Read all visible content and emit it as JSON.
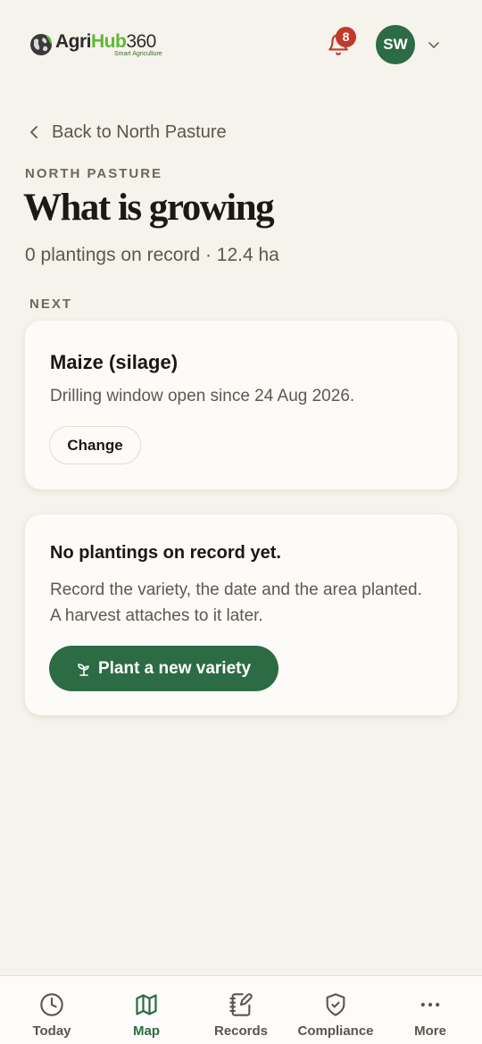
{
  "header": {
    "logo": {
      "word_agri": "Agri",
      "word_hub": "Hub",
      "word_num": "360",
      "tagline": "Smart Agriculture"
    },
    "notifications_count": "8",
    "avatar_initials": "SW"
  },
  "back_link": {
    "label": "Back to North Pasture"
  },
  "page": {
    "eyebrow": "NORTH PASTURE",
    "title": "What is growing",
    "subtitle": "0 plantings on record · 12.4 ha"
  },
  "next_section": {
    "label": "NEXT",
    "crop": "Maize (silage)",
    "description": "Drilling window open since 24 Aug 2026.",
    "change_label": "Change"
  },
  "empty_state": {
    "title": "No plantings on record yet.",
    "description": "Record the variety, the date and the area planted. A harvest attaches to it later.",
    "cta_label": "Plant a new variety"
  },
  "bottom_nav": {
    "items": [
      {
        "label": "Today",
        "icon": "clock-icon"
      },
      {
        "label": "Map",
        "icon": "map-icon"
      },
      {
        "label": "Records",
        "icon": "notebook-pen-icon"
      },
      {
        "label": "Compliance",
        "icon": "shield-check-icon"
      },
      {
        "label": "More",
        "icon": "more-dots-icon"
      }
    ],
    "active": "Map"
  },
  "colors": {
    "background": "#f6f3ec",
    "brand_green": "#2c6b44",
    "badge_red": "#c0392b",
    "logo_green": "#5cb833"
  }
}
